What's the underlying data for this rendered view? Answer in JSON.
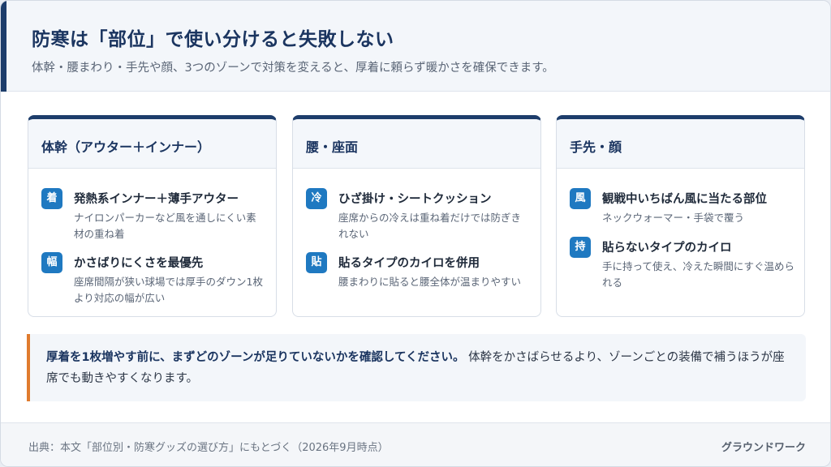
{
  "header": {
    "title": "防寒は「部位」で使い分けると失敗しない",
    "subtitle": "体幹・腰まわり・手先や顔、3つのゾーンで対策を変えると、厚着に頼らず暖かさを確保できます。"
  },
  "cards": [
    {
      "title": "体幹（アウター＋インナー）",
      "items": [
        {
          "badge": "着",
          "title": "発熱系インナー＋薄手アウター",
          "desc": "ナイロンパーカーなど風を通しにくい素材の重ね着"
        },
        {
          "badge": "幅",
          "title": "かさばりにくさを最優先",
          "desc": "座席間隔が狭い球場では厚手のダウン1枚より対応の幅が広い"
        }
      ]
    },
    {
      "title": "腰・座面",
      "items": [
        {
          "badge": "冷",
          "title": "ひざ掛け・シートクッション",
          "desc": "座席からの冷えは重ね着だけでは防ぎきれない"
        },
        {
          "badge": "貼",
          "title": "貼るタイプのカイロを併用",
          "desc": "腰まわりに貼ると腰全体が温まりやすい"
        }
      ]
    },
    {
      "title": "手先・顔",
      "items": [
        {
          "badge": "風",
          "title": "観戦中いちばん風に当たる部位",
          "desc": "ネックウォーマー・手袋で覆う"
        },
        {
          "badge": "持",
          "title": "貼らないタイプのカイロ",
          "desc": "手に持って使え、冷えた瞬間にすぐ温められる"
        }
      ]
    }
  ],
  "callout": {
    "strong": "厚着を1枚増やす前に、まずどのゾーンが足りていないかを確認してください。",
    "text": " 体幹をかさばらせるより、ゾーンごとの装備で補うほうが座席でも動きやすくなります。"
  },
  "footer": {
    "source": "出典：本文「部位別・防寒グッズの選び方」にもとづく（2026年9月時点）",
    "brand": "グラウンドワーク"
  },
  "colors": {
    "accent": "#1d3d6b",
    "badge": "#1f79c1",
    "callout_border": "#e07b2e"
  }
}
